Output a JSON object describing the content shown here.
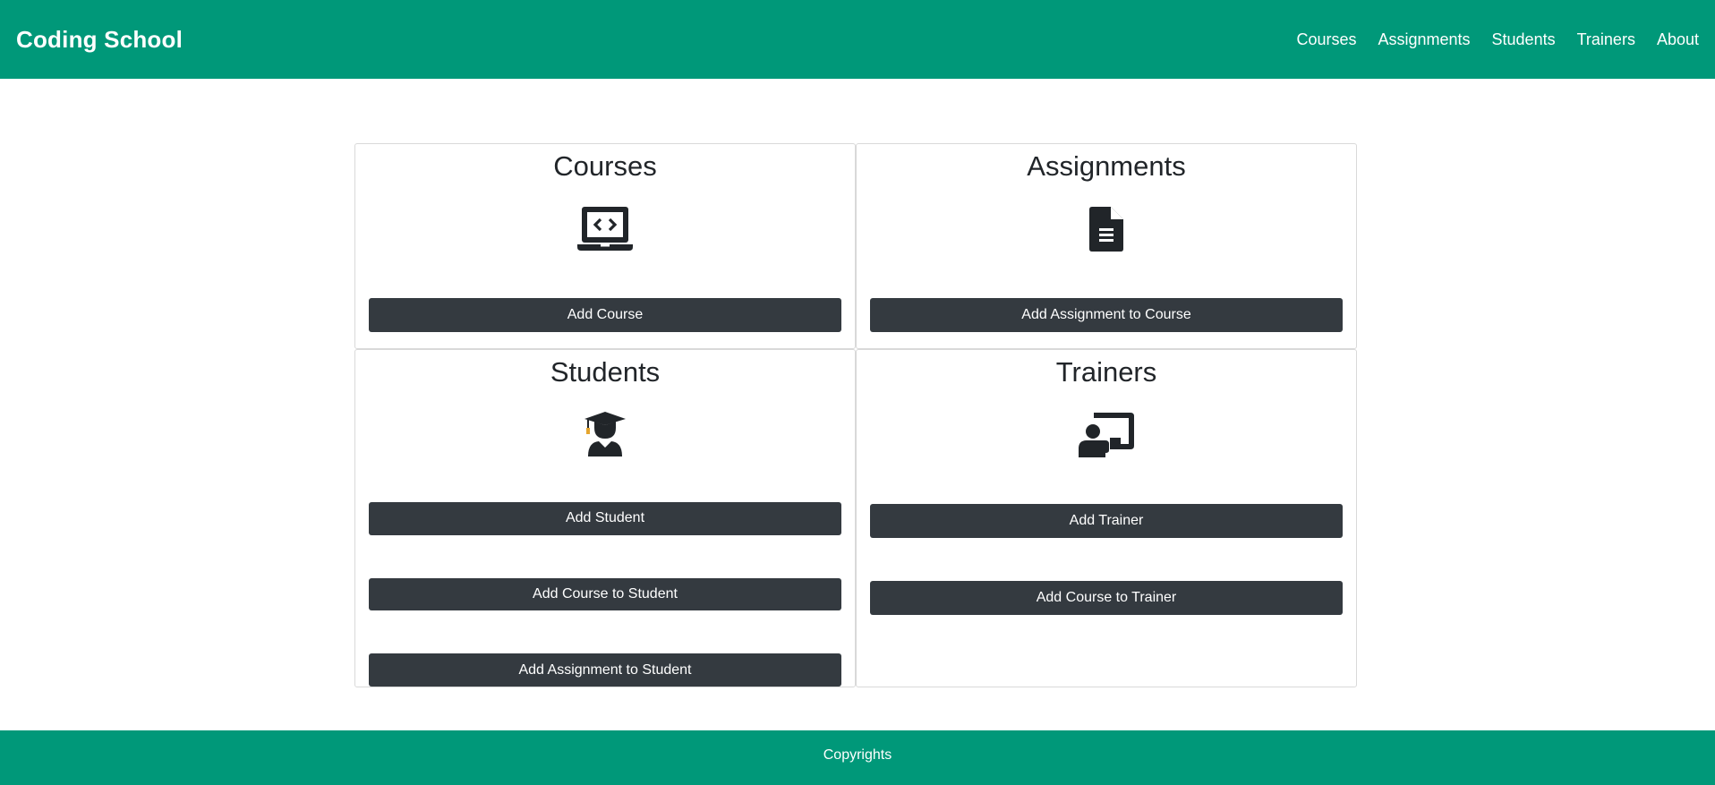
{
  "navbar": {
    "brand": "Coding School",
    "links": [
      "Courses",
      "Assignments",
      "Students",
      "Trainers",
      "About"
    ]
  },
  "cards": {
    "courses": {
      "title": "Courses",
      "icon": "laptop-code-icon",
      "buttons": [
        "Add Course"
      ]
    },
    "assignments": {
      "title": "Assignments",
      "icon": "file-document-icon",
      "buttons": [
        "Add Assignment to Course"
      ]
    },
    "students": {
      "title": "Students",
      "icon": "graduate-student-icon",
      "buttons": [
        "Add Student",
        "Add Course to Student",
        "Add Assignment to Student"
      ]
    },
    "trainers": {
      "title": "Trainers",
      "icon": "chalkboard-teacher-icon",
      "buttons": [
        "Add Trainer",
        "Add Course to Trainer"
      ]
    }
  },
  "footer": {
    "text": "Copyrights"
  },
  "colors": {
    "brand_green": "#009879",
    "button_dark": "#343a40",
    "icon_dark": "#212529"
  }
}
